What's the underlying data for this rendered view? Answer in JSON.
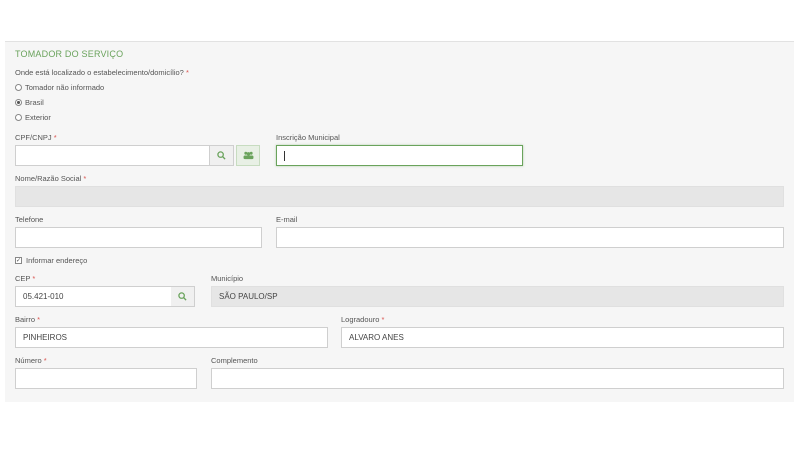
{
  "section": {
    "title": "TOMADOR DO SERVIÇO"
  },
  "location_question": {
    "label": "Onde está localizado o estabelecimento/domicílio?",
    "required": "*"
  },
  "radios": [
    {
      "label": "Tomador não informado",
      "selected": false
    },
    {
      "label": "Brasil",
      "selected": true
    },
    {
      "label": "Exterior",
      "selected": false
    }
  ],
  "cpf_cnpj": {
    "label": "CPF/CNPJ",
    "required": "*",
    "value": ""
  },
  "inscricao_municipal": {
    "label": "Inscrição Municipal",
    "value": ""
  },
  "nome": {
    "label": "Nome/Razão Social",
    "required": "*",
    "value": ""
  },
  "telefone": {
    "label": "Telefone",
    "value": ""
  },
  "email": {
    "label": "E-mail",
    "value": ""
  },
  "informar_endereco": {
    "label": "Informar endereço",
    "checked": true,
    "check_glyph": "✓"
  },
  "cep": {
    "label": "CEP",
    "required": "*",
    "value": "05.421-010"
  },
  "municipio": {
    "label": "Município",
    "value": "SÃO PAULO/SP"
  },
  "bairro": {
    "label": "Bairro",
    "required": "*",
    "value": "PINHEIROS"
  },
  "logradouro": {
    "label": "Logradouro",
    "required": "*",
    "value": "ALVARO ANES"
  },
  "numero": {
    "label": "Número",
    "required": "*",
    "value": ""
  },
  "complemento": {
    "label": "Complemento",
    "value": ""
  },
  "icons": {
    "search": "search-icon",
    "users": "users-icon"
  },
  "colors": {
    "accent": "#6aa35c",
    "required": "#d9534f",
    "disabled_bg": "#e6e6e6",
    "panel_bg": "#f6f6f6"
  }
}
